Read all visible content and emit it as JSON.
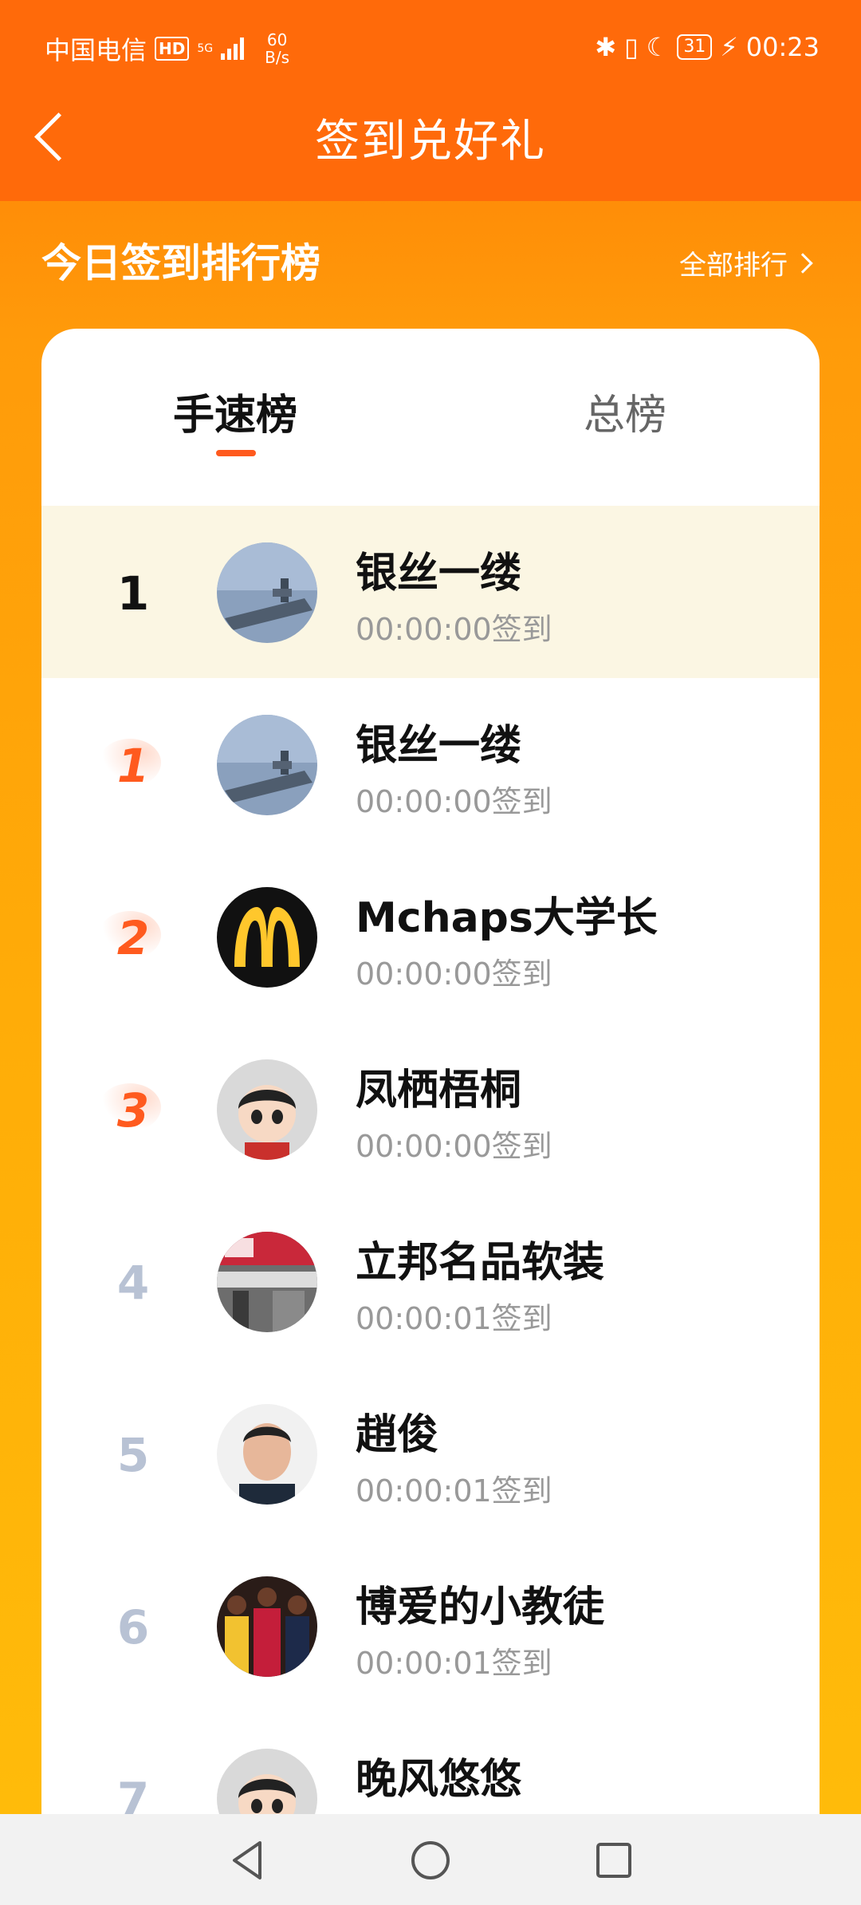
{
  "status_bar": {
    "carrier": "中国电信",
    "hd": "HD",
    "network": "5G",
    "speed_value": "60",
    "speed_unit": "B/s",
    "battery": "31",
    "time": "00:23"
  },
  "nav": {
    "title": "签到兑好礼"
  },
  "section": {
    "title": "今日签到排行榜",
    "all_rank": "全部排行"
  },
  "tabs": [
    {
      "label": "手速榜",
      "active": true
    },
    {
      "label": "总榜",
      "active": false
    }
  ],
  "my_entry": {
    "rank": "1",
    "name": "银丝一缕",
    "time": "00:00:00签到",
    "avatar": "aircraft-carrier-avatar"
  },
  "rows": [
    {
      "rank": "1",
      "name": "银丝一缕",
      "time": "00:00:00签到",
      "avatar": "aircraft-carrier-avatar"
    },
    {
      "rank": "2",
      "name": "Mchaps大学长",
      "time": "00:00:00签到",
      "avatar": "mcdonalds-logo-avatar"
    },
    {
      "rank": "3",
      "name": "凤栖梧桐",
      "time": "00:00:00签到",
      "avatar": "cartoon-child-avatar"
    },
    {
      "rank": "4",
      "name": "立邦名品软装",
      "time": "00:00:01签到",
      "avatar": "storefront-avatar"
    },
    {
      "rank": "5",
      "name": "趙俊",
      "time": "00:00:01签到",
      "avatar": "man-portrait-avatar"
    },
    {
      "rank": "6",
      "name": "博爱的小教徒",
      "time": "00:00:01签到",
      "avatar": "basketball-players-avatar"
    },
    {
      "rank": "7",
      "name": "晚风悠悠",
      "time": "",
      "avatar": "cartoon-child-avatar"
    }
  ],
  "colors": {
    "brand": "#ff6a0a",
    "accent": "#ff5a1e",
    "highlight_row": "#fbf6e3"
  }
}
